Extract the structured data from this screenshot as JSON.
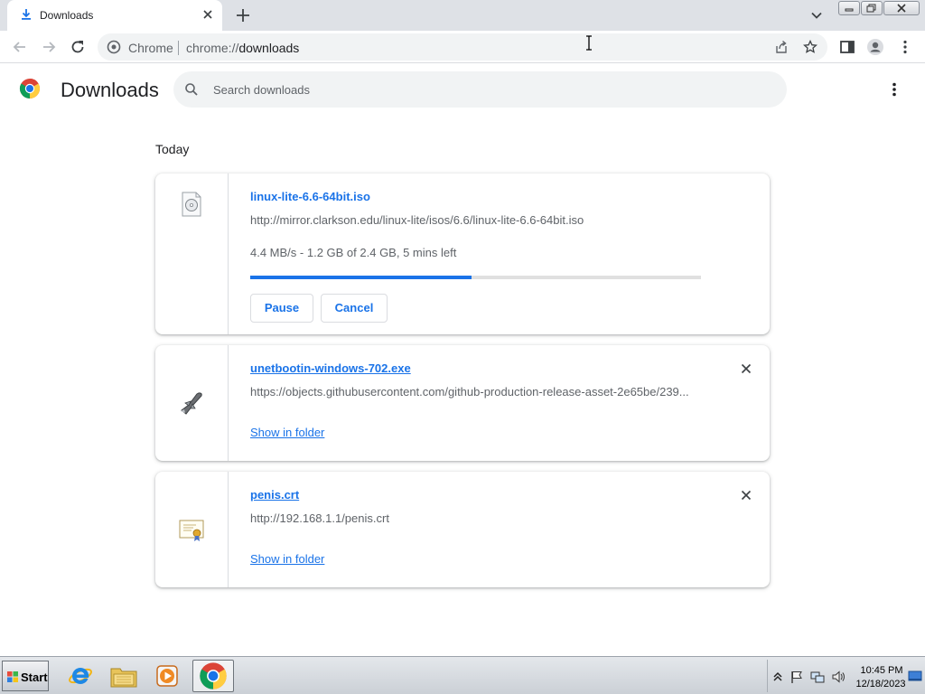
{
  "browser": {
    "tab": {
      "title": "Downloads"
    },
    "omnibox": {
      "chip": "Chrome",
      "url_scheme": "chrome://",
      "url_path": "downloads"
    }
  },
  "page": {
    "title": "Downloads",
    "search_placeholder": "Search downloads",
    "section_label": "Today"
  },
  "downloads": [
    {
      "filename": "linux-lite-6.6-64bit.iso",
      "url": "http://mirror.clarkson.edu/linux-lite/isos/6.6/linux-lite-6.6-64bit.iso",
      "status": "4.4 MB/s - 1.2 GB of 2.4 GB, 5 mins left",
      "progress_fraction": 0.49,
      "pause_label": "Pause",
      "cancel_label": "Cancel",
      "icon": "disc-file-icon"
    },
    {
      "filename": "unetbootin-windows-702.exe",
      "url": "https://objects.githubusercontent.com/github-production-release-asset-2e65be/239...",
      "show_in_folder_label": "Show in folder",
      "icon": "executable-icon"
    },
    {
      "filename": "penis.crt",
      "url": "http://192.168.1.1/penis.crt",
      "show_in_folder_label": "Show in folder",
      "icon": "certificate-icon"
    }
  ],
  "taskbar": {
    "start_label": "Start",
    "clock_time": "10:45 PM",
    "clock_date": "12/18/2023",
    "apps": [
      "internet-explorer-icon",
      "file-explorer-icon",
      "media-player-icon",
      "chrome-icon"
    ]
  },
  "colors": {
    "accent": "#1a73e8",
    "secondary_text": "#5f6368",
    "tabstrip": "#dee1e6"
  }
}
